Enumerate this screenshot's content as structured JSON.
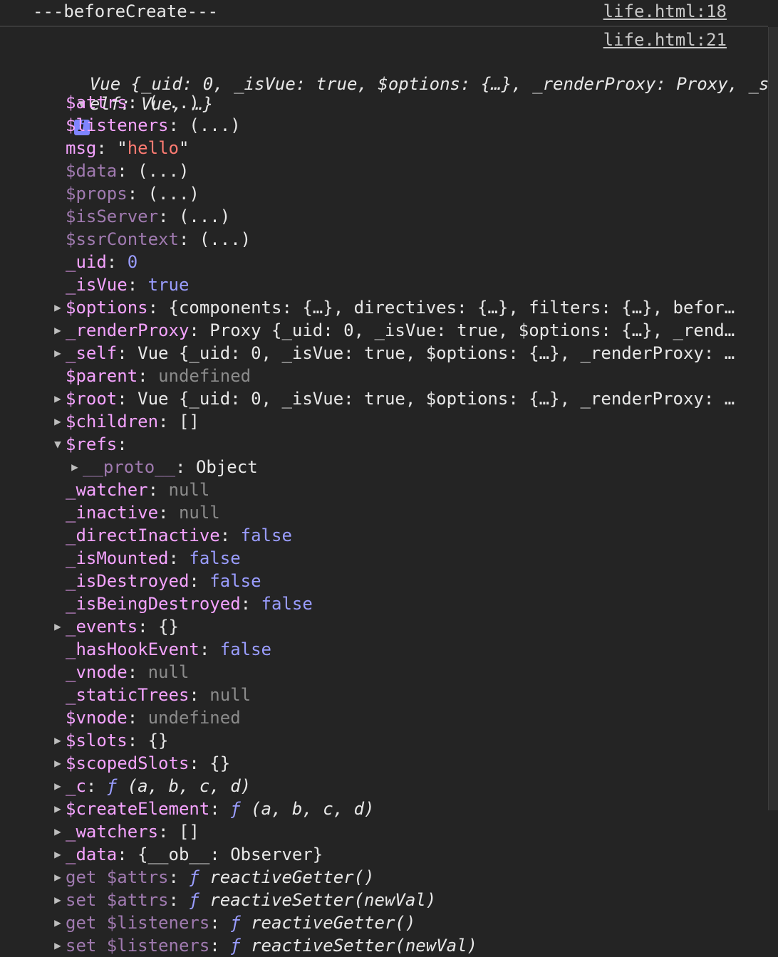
{
  "log": {
    "title": "---beforeCreate---",
    "link1": "life.html:18",
    "link2": "life.html:21"
  },
  "summary": {
    "line1": "Vue {_uid: 0, _isVue: true, $options: {…}, _renderProxy: Proxy, _s",
    "line2": "elf: Vue, …}",
    "info": "i"
  },
  "props": [
    {
      "tri": "",
      "key": "$attrs",
      "val": "(...)",
      "vclass": "p"
    },
    {
      "tri": "",
      "key": "$listeners",
      "val": "(...)",
      "vclass": "p"
    },
    {
      "tri": "",
      "key": "msg",
      "val": "\"hello\"",
      "vclass": "str"
    },
    {
      "tri": "",
      "key": "$data",
      "val": "(...)",
      "vclass": "p",
      "dim": true
    },
    {
      "tri": "",
      "key": "$props",
      "val": "(...)",
      "vclass": "p",
      "dim": true
    },
    {
      "tri": "",
      "key": "$isServer",
      "val": "(...)",
      "vclass": "p",
      "dim": true
    },
    {
      "tri": "",
      "key": "$ssrContext",
      "val": "(...)",
      "vclass": "p",
      "dim": true
    },
    {
      "tri": "",
      "key": "_uid",
      "val": "0",
      "vclass": "num"
    },
    {
      "tri": "",
      "key": "_isVue",
      "val": "true",
      "vclass": "bool"
    },
    {
      "tri": "▶",
      "key": "$options",
      "val": "{components: {…}, directives: {…}, filters: {…}, befor…",
      "vclass": "p"
    },
    {
      "tri": "▶",
      "key": "_renderProxy",
      "val": "Proxy {_uid: 0, _isVue: true, $options: {…}, _rend…",
      "vclass": "p"
    },
    {
      "tri": "▶",
      "key": "_self",
      "val": "Vue {_uid: 0, _isVue: true, $options: {…}, _renderProxy: …",
      "vclass": "p"
    },
    {
      "tri": "",
      "key": "$parent",
      "val": "undefined",
      "vclass": "nul"
    },
    {
      "tri": "▶",
      "key": "$root",
      "val": "Vue {_uid: 0, _isVue: true, $options: {…}, _renderProxy: …",
      "vclass": "p"
    },
    {
      "tri": "▶",
      "key": "$children",
      "val": "[]",
      "vclass": "p"
    },
    {
      "tri": "▼",
      "key": "$refs",
      "val": "",
      "vclass": "p"
    },
    {
      "tri": "▶",
      "key": "__proto__",
      "val": "Object",
      "vclass": "p",
      "indent": true,
      "dim": true
    },
    {
      "tri": "",
      "key": "_watcher",
      "val": "null",
      "vclass": "nul"
    },
    {
      "tri": "",
      "key": "_inactive",
      "val": "null",
      "vclass": "nul"
    },
    {
      "tri": "",
      "key": "_directInactive",
      "val": "false",
      "vclass": "bool"
    },
    {
      "tri": "",
      "key": "_isMounted",
      "val": "false",
      "vclass": "bool"
    },
    {
      "tri": "",
      "key": "_isDestroyed",
      "val": "false",
      "vclass": "bool"
    },
    {
      "tri": "",
      "key": "_isBeingDestroyed",
      "val": "false",
      "vclass": "bool"
    },
    {
      "tri": "▶",
      "key": "_events",
      "val": "{}",
      "vclass": "p"
    },
    {
      "tri": "",
      "key": "_hasHookEvent",
      "val": "false",
      "vclass": "bool"
    },
    {
      "tri": "",
      "key": "_vnode",
      "val": "null",
      "vclass": "nul"
    },
    {
      "tri": "",
      "key": "_staticTrees",
      "val": "null",
      "vclass": "nul"
    },
    {
      "tri": "",
      "key": "$vnode",
      "val": "undefined",
      "vclass": "nul"
    },
    {
      "tri": "▶",
      "key": "$slots",
      "val": "{}",
      "vclass": "p"
    },
    {
      "tri": "▶",
      "key": "$scopedSlots",
      "val": "{}",
      "vclass": "p"
    },
    {
      "tri": "▶",
      "key": "_c",
      "val": "ƒ (a, b, c, d)",
      "vclass": "fn"
    },
    {
      "tri": "▶",
      "key": "$createElement",
      "val": "ƒ (a, b, c, d)",
      "vclass": "fn"
    },
    {
      "tri": "▶",
      "key": "_watchers",
      "val": "[]",
      "vclass": "p"
    },
    {
      "tri": "▶",
      "key": "_data",
      "val": "{__ob__: Observer}",
      "vclass": "p"
    },
    {
      "tri": "▶",
      "key": "get $attrs",
      "val": "ƒ reactiveGetter()",
      "vclass": "fn",
      "dim": true
    },
    {
      "tri": "▶",
      "key": "set $attrs",
      "val": "ƒ reactiveSetter(newVal)",
      "vclass": "fn",
      "dim": true
    },
    {
      "tri": "▶",
      "key": "get $listeners",
      "val": "ƒ reactiveGetter()",
      "vclass": "fn",
      "dim": true
    },
    {
      "tri": "▶",
      "key": "set $listeners",
      "val": "ƒ reactiveSetter(newVal)",
      "vclass": "fn",
      "dim": true
    }
  ]
}
